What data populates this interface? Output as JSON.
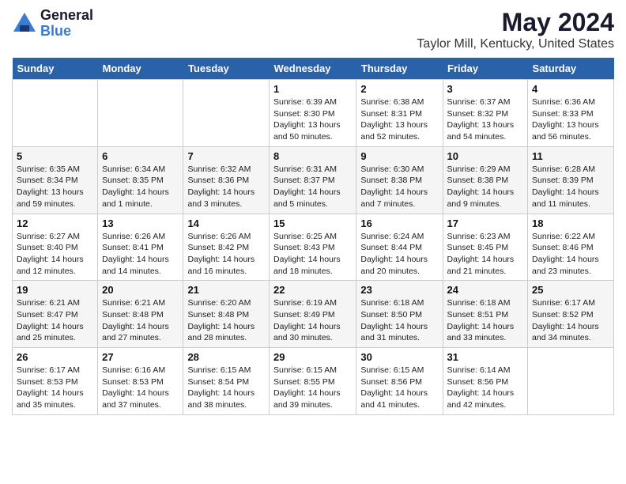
{
  "header": {
    "logo_line1": "General",
    "logo_line2": "Blue",
    "main_title": "May 2024",
    "subtitle": "Taylor Mill, Kentucky, United States"
  },
  "calendar": {
    "days_of_week": [
      "Sunday",
      "Monday",
      "Tuesday",
      "Wednesday",
      "Thursday",
      "Friday",
      "Saturday"
    ],
    "weeks": [
      [
        {
          "num": "",
          "sunrise": "",
          "sunset": "",
          "daylight": ""
        },
        {
          "num": "",
          "sunrise": "",
          "sunset": "",
          "daylight": ""
        },
        {
          "num": "",
          "sunrise": "",
          "sunset": "",
          "daylight": ""
        },
        {
          "num": "1",
          "sunrise": "Sunrise: 6:39 AM",
          "sunset": "Sunset: 8:30 PM",
          "daylight": "Daylight: 13 hours and 50 minutes."
        },
        {
          "num": "2",
          "sunrise": "Sunrise: 6:38 AM",
          "sunset": "Sunset: 8:31 PM",
          "daylight": "Daylight: 13 hours and 52 minutes."
        },
        {
          "num": "3",
          "sunrise": "Sunrise: 6:37 AM",
          "sunset": "Sunset: 8:32 PM",
          "daylight": "Daylight: 13 hours and 54 minutes."
        },
        {
          "num": "4",
          "sunrise": "Sunrise: 6:36 AM",
          "sunset": "Sunset: 8:33 PM",
          "daylight": "Daylight: 13 hours and 56 minutes."
        }
      ],
      [
        {
          "num": "5",
          "sunrise": "Sunrise: 6:35 AM",
          "sunset": "Sunset: 8:34 PM",
          "daylight": "Daylight: 13 hours and 59 minutes."
        },
        {
          "num": "6",
          "sunrise": "Sunrise: 6:34 AM",
          "sunset": "Sunset: 8:35 PM",
          "daylight": "Daylight: 14 hours and 1 minute."
        },
        {
          "num": "7",
          "sunrise": "Sunrise: 6:32 AM",
          "sunset": "Sunset: 8:36 PM",
          "daylight": "Daylight: 14 hours and 3 minutes."
        },
        {
          "num": "8",
          "sunrise": "Sunrise: 6:31 AM",
          "sunset": "Sunset: 8:37 PM",
          "daylight": "Daylight: 14 hours and 5 minutes."
        },
        {
          "num": "9",
          "sunrise": "Sunrise: 6:30 AM",
          "sunset": "Sunset: 8:38 PM",
          "daylight": "Daylight: 14 hours and 7 minutes."
        },
        {
          "num": "10",
          "sunrise": "Sunrise: 6:29 AM",
          "sunset": "Sunset: 8:38 PM",
          "daylight": "Daylight: 14 hours and 9 minutes."
        },
        {
          "num": "11",
          "sunrise": "Sunrise: 6:28 AM",
          "sunset": "Sunset: 8:39 PM",
          "daylight": "Daylight: 14 hours and 11 minutes."
        }
      ],
      [
        {
          "num": "12",
          "sunrise": "Sunrise: 6:27 AM",
          "sunset": "Sunset: 8:40 PM",
          "daylight": "Daylight: 14 hours and 12 minutes."
        },
        {
          "num": "13",
          "sunrise": "Sunrise: 6:26 AM",
          "sunset": "Sunset: 8:41 PM",
          "daylight": "Daylight: 14 hours and 14 minutes."
        },
        {
          "num": "14",
          "sunrise": "Sunrise: 6:26 AM",
          "sunset": "Sunset: 8:42 PM",
          "daylight": "Daylight: 14 hours and 16 minutes."
        },
        {
          "num": "15",
          "sunrise": "Sunrise: 6:25 AM",
          "sunset": "Sunset: 8:43 PM",
          "daylight": "Daylight: 14 hours and 18 minutes."
        },
        {
          "num": "16",
          "sunrise": "Sunrise: 6:24 AM",
          "sunset": "Sunset: 8:44 PM",
          "daylight": "Daylight: 14 hours and 20 minutes."
        },
        {
          "num": "17",
          "sunrise": "Sunrise: 6:23 AM",
          "sunset": "Sunset: 8:45 PM",
          "daylight": "Daylight: 14 hours and 21 minutes."
        },
        {
          "num": "18",
          "sunrise": "Sunrise: 6:22 AM",
          "sunset": "Sunset: 8:46 PM",
          "daylight": "Daylight: 14 hours and 23 minutes."
        }
      ],
      [
        {
          "num": "19",
          "sunrise": "Sunrise: 6:21 AM",
          "sunset": "Sunset: 8:47 PM",
          "daylight": "Daylight: 14 hours and 25 minutes."
        },
        {
          "num": "20",
          "sunrise": "Sunrise: 6:21 AM",
          "sunset": "Sunset: 8:48 PM",
          "daylight": "Daylight: 14 hours and 27 minutes."
        },
        {
          "num": "21",
          "sunrise": "Sunrise: 6:20 AM",
          "sunset": "Sunset: 8:48 PM",
          "daylight": "Daylight: 14 hours and 28 minutes."
        },
        {
          "num": "22",
          "sunrise": "Sunrise: 6:19 AM",
          "sunset": "Sunset: 8:49 PM",
          "daylight": "Daylight: 14 hours and 30 minutes."
        },
        {
          "num": "23",
          "sunrise": "Sunrise: 6:18 AM",
          "sunset": "Sunset: 8:50 PM",
          "daylight": "Daylight: 14 hours and 31 minutes."
        },
        {
          "num": "24",
          "sunrise": "Sunrise: 6:18 AM",
          "sunset": "Sunset: 8:51 PM",
          "daylight": "Daylight: 14 hours and 33 minutes."
        },
        {
          "num": "25",
          "sunrise": "Sunrise: 6:17 AM",
          "sunset": "Sunset: 8:52 PM",
          "daylight": "Daylight: 14 hours and 34 minutes."
        }
      ],
      [
        {
          "num": "26",
          "sunrise": "Sunrise: 6:17 AM",
          "sunset": "Sunset: 8:53 PM",
          "daylight": "Daylight: 14 hours and 35 minutes."
        },
        {
          "num": "27",
          "sunrise": "Sunrise: 6:16 AM",
          "sunset": "Sunset: 8:53 PM",
          "daylight": "Daylight: 14 hours and 37 minutes."
        },
        {
          "num": "28",
          "sunrise": "Sunrise: 6:15 AM",
          "sunset": "Sunset: 8:54 PM",
          "daylight": "Daylight: 14 hours and 38 minutes."
        },
        {
          "num": "29",
          "sunrise": "Sunrise: 6:15 AM",
          "sunset": "Sunset: 8:55 PM",
          "daylight": "Daylight: 14 hours and 39 minutes."
        },
        {
          "num": "30",
          "sunrise": "Sunrise: 6:15 AM",
          "sunset": "Sunset: 8:56 PM",
          "daylight": "Daylight: 14 hours and 41 minutes."
        },
        {
          "num": "31",
          "sunrise": "Sunrise: 6:14 AM",
          "sunset": "Sunset: 8:56 PM",
          "daylight": "Daylight: 14 hours and 42 minutes."
        },
        {
          "num": "",
          "sunrise": "",
          "sunset": "",
          "daylight": ""
        }
      ]
    ]
  }
}
